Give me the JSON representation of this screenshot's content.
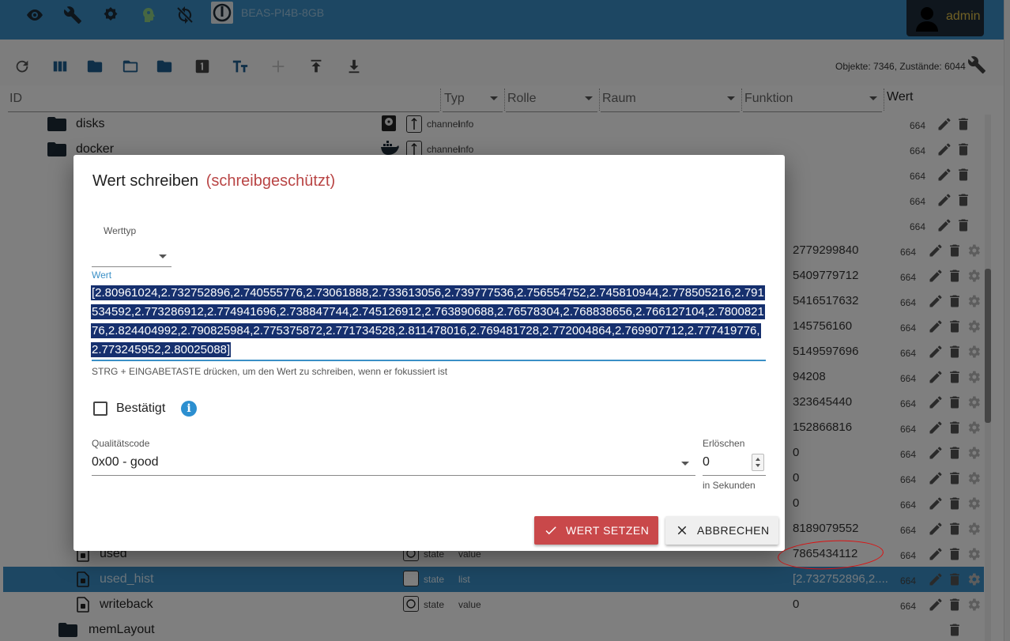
{
  "header": {
    "hostname": "BEAS-PI4B-8GB",
    "username": "admin",
    "icons": [
      "eye-icon",
      "wrench-icon",
      "settings-icon",
      "head-icon",
      "sync-off-icon",
      "iobroker-logo"
    ]
  },
  "toolbar": {
    "icons": [
      "refresh-icon",
      "columns-icon",
      "folder-icon",
      "folder-open-icon",
      "folder-icon",
      "count-1-icon",
      "text-format-icon",
      "add-icon",
      "upload-icon",
      "download-icon"
    ],
    "counts": "Objekte: 7346, Zustände: 6044"
  },
  "columns": {
    "id": "ID",
    "type": "Typ",
    "role": "Rolle",
    "room": "Raum",
    "function": "Funktion",
    "value": "Wert"
  },
  "tree": {
    "rows": [
      {
        "name": "disks",
        "type": "channel",
        "role": "info",
        "value": "",
        "num": "664"
      },
      {
        "name": "docker",
        "type": "channel",
        "role": "info",
        "value": "",
        "num": "664"
      },
      {
        "name": "",
        "type": "",
        "role": "",
        "value": "",
        "num": "664"
      },
      {
        "name": "",
        "type": "",
        "role": "",
        "value": "",
        "num": "664"
      },
      {
        "name": "",
        "type": "",
        "role": "",
        "value": "",
        "num": "664"
      },
      {
        "name": "",
        "type": "",
        "role": "",
        "value": "2779299840",
        "num": "664"
      },
      {
        "name": "",
        "type": "",
        "role": "",
        "value": "5409779712",
        "num": "664"
      },
      {
        "name": "",
        "type": "",
        "role": "",
        "value": "5416517632",
        "num": "664"
      },
      {
        "name": "",
        "type": "",
        "role": "",
        "value": "145756160",
        "num": "664"
      },
      {
        "name": "",
        "type": "",
        "role": "",
        "value": "5149597696",
        "num": "664"
      },
      {
        "name": "",
        "type": "",
        "role": "",
        "value": "94208",
        "num": "664"
      },
      {
        "name": "",
        "type": "",
        "role": "",
        "value": "323645440",
        "num": "664"
      },
      {
        "name": "",
        "type": "",
        "role": "",
        "value": "152866816",
        "num": "664"
      },
      {
        "name": "",
        "type": "",
        "role": "",
        "value": "0",
        "num": "664"
      },
      {
        "name": "",
        "type": "",
        "role": "",
        "value": "0",
        "num": "664"
      },
      {
        "name": "",
        "type": "",
        "role": "",
        "value": "0",
        "num": "664"
      },
      {
        "name": "",
        "type": "",
        "role": "",
        "value": "8189079552",
        "num": "664"
      },
      {
        "name": "used",
        "type": "state",
        "role": "value",
        "value": "7865434112",
        "num": "664"
      },
      {
        "name": "used_hist",
        "type": "state",
        "role": "list",
        "value": "[2.732752896,2....",
        "num": "664"
      },
      {
        "name": "writeback",
        "type": "state",
        "role": "value",
        "value": "0",
        "num": "664"
      },
      {
        "name": "memLayout",
        "type": "",
        "role": "",
        "value": "",
        "num": ""
      }
    ]
  },
  "dialog": {
    "title": "Wert schreiben",
    "readonly": "(schreibgeschützt)",
    "value_type_label": "Werttyp",
    "value_label": "Wert",
    "value_text": "[2.80961024,2.732752896,2.740555776,2.73061888,2.733613056,2.739777536,2.756554752,2.745810944,2.778505216,2.791534592,2.773286912,2.774941696,2.738847744,2.745126912,2.763890688,2.76578304,2.768838656,2.766127104,2.780082176,2.824404992,2.790825984,2.775375872,2.771734528,2.811478016,2.769481728,2.772004864,2.769907712,2.777419776,2.773245952,2.80025088]",
    "hint": "STRG + EINGABETASTE drücken, um den Wert zu schreiben, wenn er fokussiert ist",
    "ack_label": "Bestätigt",
    "quality_label": "Qualitätscode",
    "quality_value": "0x00 - good",
    "expire_label": "Erlöschen",
    "expire_value": "0",
    "expire_unit": "in Sekunden",
    "set_button": "WERT SETZEN",
    "cancel_button": "ABBRECHEN"
  },
  "colors": {
    "header_bg": "#3a8fc6",
    "accent": "#3a8fc6",
    "selection_bg": "#16306e",
    "danger": "#c9484a",
    "readonly_text": "#b94545"
  }
}
